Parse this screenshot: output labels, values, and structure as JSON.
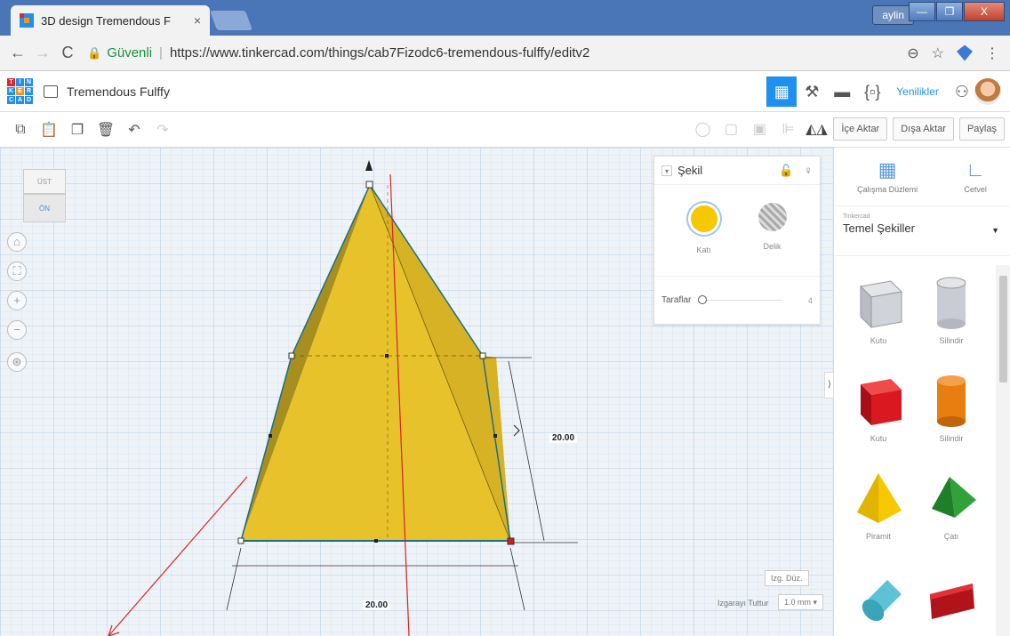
{
  "browser": {
    "tab_title": "3D design Tremendous F",
    "tab_close": "×",
    "window_user": "aylin",
    "secure_label": "Güvenli",
    "url": "https://www.tinkercad.com/things/cab7Fizodc6-tremendous-fulffy/editv2",
    "window_controls": {
      "minimize": "—",
      "maximize": "❐",
      "close": "X"
    }
  },
  "app": {
    "logo_letters": [
      "T",
      "I",
      "N",
      "K",
      "E",
      "R",
      "C",
      "A",
      "D"
    ],
    "logo_colors": [
      "#e2232a",
      "#1f8ff0",
      "#1f8ff0",
      "#1f8ff0",
      "#f7941d",
      "#1f8ff0",
      "#1f8ff0",
      "#1f8ff0",
      "#1f8ff0"
    ],
    "document_name": "Tremendous Fulffy",
    "news_label": "Yenilikler",
    "accent": "#1f8ff0"
  },
  "toolbar": {
    "import_label": "İçe Aktar",
    "export_label": "Dışa Aktar",
    "share_label": "Paylaş"
  },
  "viewcube": {
    "top_label": "ÜST",
    "front_label": "ÖN"
  },
  "shape_panel": {
    "title": "Şekil",
    "solid_label": "Katı",
    "hole_label": "Delik",
    "sides_label": "Taraflar",
    "sides_value": "4",
    "solid_color": "#f5c800"
  },
  "dimensions": {
    "height": "20.00",
    "width": "20.00"
  },
  "grid": {
    "edit_grid_label": "Izg. Düz.",
    "snap_label": "Izgarayı Tuttur",
    "snap_value": "1.0 mm ▾"
  },
  "right_panel": {
    "workplane_label": "Çalışma Düzlemi",
    "ruler_label": "Cetvel",
    "library_small": "Tinkercad",
    "library_name": "Temel Şekiller",
    "shapes": [
      {
        "label": "Kutu",
        "color": "#c9ccd2"
      },
      {
        "label": "Silindir",
        "color": "#c9ccd2"
      },
      {
        "label": "Kutu",
        "color": "#d9191f"
      },
      {
        "label": "Silindir",
        "color": "#e67e10"
      },
      {
        "label": "Piramit",
        "color": "#f5c800"
      },
      {
        "label": "Çatı",
        "color": "#2fa23a"
      }
    ]
  }
}
